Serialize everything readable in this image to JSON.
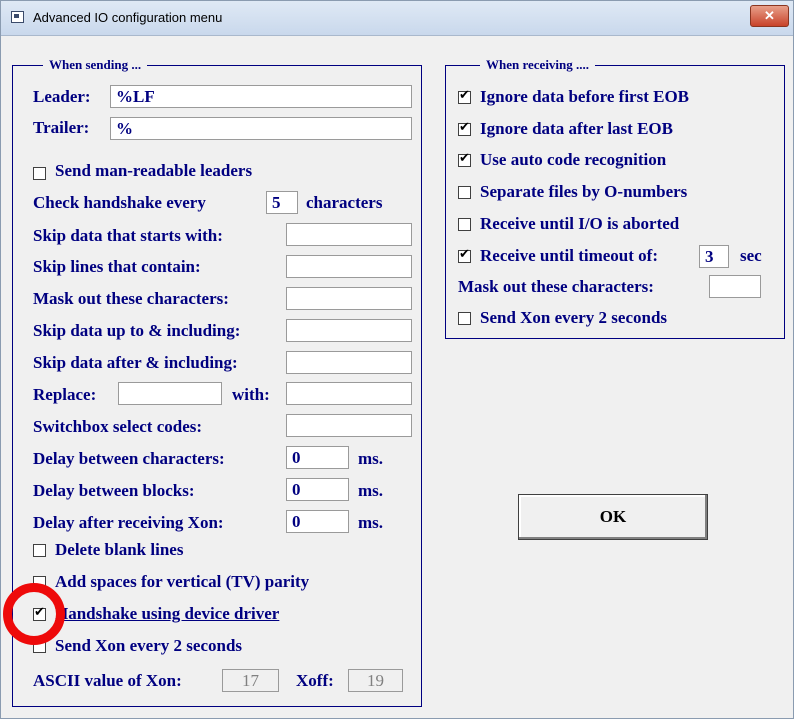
{
  "window": {
    "title": "Advanced IO configuration menu",
    "close_label": "✕"
  },
  "sending": {
    "legend": "When sending ...",
    "leader_label": "Leader:",
    "leader_value": "%LF",
    "trailer_label": "Trailer:",
    "trailer_value": "%",
    "send_man_readable": {
      "label": "Send man-readable leaders",
      "checked": false
    },
    "check_handshake_label": "Check handshake every",
    "check_handshake_value": "5",
    "check_handshake_unit": "characters",
    "skip_starts_label": "Skip data that starts with:",
    "skip_lines_label": "Skip lines that contain:",
    "mask_label": "Mask out these characters:",
    "skip_up_to_label": "Skip data up to & including:",
    "skip_after_label": "Skip data after & including:",
    "replace_label": "Replace:",
    "with_label": "with:",
    "switchbox_label": "Switchbox select codes:",
    "delay_chars_label": "Delay between characters:",
    "delay_chars_value": "0",
    "delay_blocks_label": "Delay between blocks:",
    "delay_blocks_value": "0",
    "delay_xon_label": "Delay after receiving Xon:",
    "delay_xon_value": "0",
    "ms_label": "ms.",
    "delete_blank": {
      "label": "Delete blank lines",
      "checked": false
    },
    "add_spaces": {
      "label": "Add spaces for vertical (TV) parity",
      "checked": false
    },
    "handshake_driver": {
      "label": "Handshake using device driver",
      "checked": true
    },
    "send_xon": {
      "label": "Send Xon every 2 seconds",
      "checked": false
    },
    "xon_label": "ASCII value of Xon:",
    "xon_value": "17",
    "xoff_label": "Xoff:",
    "xoff_value": "19"
  },
  "receiving": {
    "legend": "When receiving ....",
    "ignore_before": {
      "label": "Ignore data before first EOB",
      "checked": true
    },
    "ignore_after": {
      "label": "Ignore data after last EOB",
      "checked": true
    },
    "auto_code": {
      "label": "Use auto code recognition",
      "checked": true
    },
    "separate_files": {
      "label": "Separate files by O-numbers",
      "checked": false
    },
    "until_aborted": {
      "label": "Receive until I/O is aborted",
      "checked": false
    },
    "until_timeout": {
      "label": "Receive until timeout of:",
      "checked": true,
      "value": "3",
      "unit": "sec"
    },
    "mask_label": "Mask out these characters:",
    "send_xon": {
      "label": "Send Xon every 2 seconds",
      "checked": false
    }
  },
  "ok_label": "OK",
  "colors": {
    "label_text": "#000080",
    "annotation_circle": "#ee0a0a"
  }
}
